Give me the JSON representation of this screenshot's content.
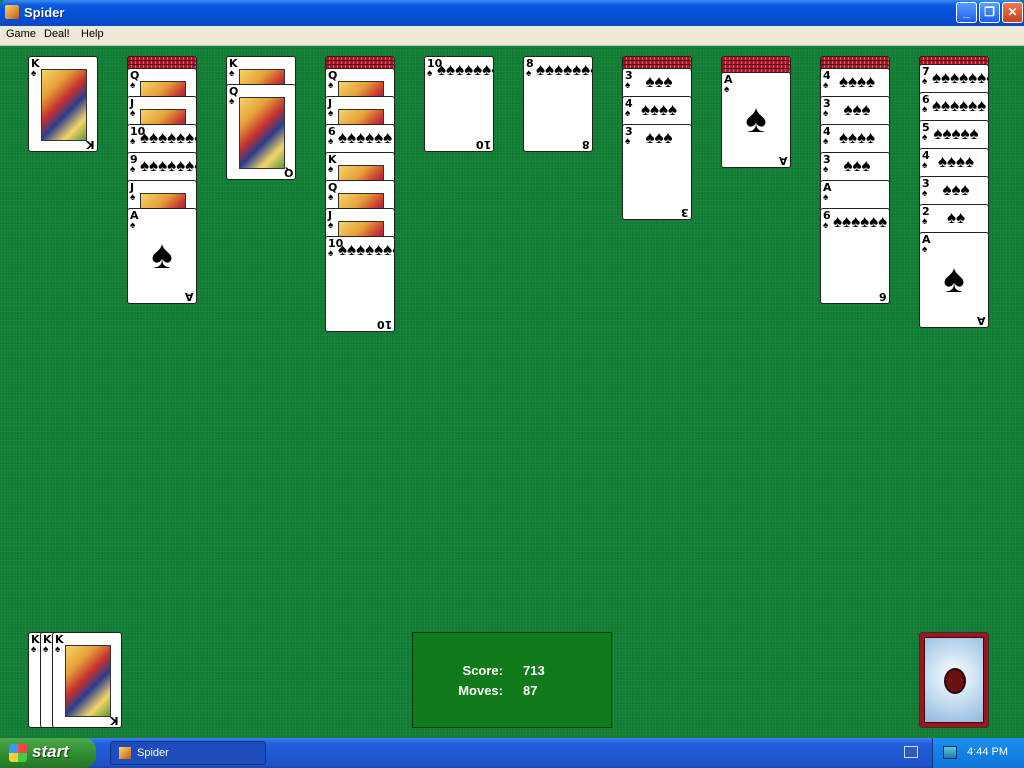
{
  "window": {
    "title": "Spider"
  },
  "menu": [
    "Game",
    "Deal!",
    "Help"
  ],
  "colors": {
    "felt": "#117c33",
    "card_back": "#b81024",
    "status_bg": "#117a1a"
  },
  "tableau": [
    {
      "backs": 0,
      "cards": [
        "K"
      ]
    },
    {
      "backs": 3,
      "cards": [
        "Q",
        "J",
        "10",
        "9",
        "J",
        "A"
      ]
    },
    {
      "backs": 0,
      "cards": [
        "K",
        "Q"
      ]
    },
    {
      "backs": 3,
      "cards": [
        "Q",
        "J",
        "6",
        "K",
        "Q",
        "J",
        "10"
      ]
    },
    {
      "backs": 0,
      "cards": [
        "10"
      ]
    },
    {
      "backs": 0,
      "cards": [
        "8"
      ]
    },
    {
      "backs": 3,
      "cards": [
        "3",
        "4",
        "3"
      ]
    },
    {
      "backs": 4,
      "cards": [
        "A"
      ]
    },
    {
      "backs": 3,
      "cards": [
        "4",
        "3",
        "4",
        "3",
        "A",
        "6"
      ]
    },
    {
      "backs": 2,
      "cards": [
        "7",
        "6",
        "5",
        "4",
        "3",
        "2",
        "A"
      ]
    }
  ],
  "completed_suits": [
    "K",
    "K",
    "K"
  ],
  "status": {
    "score_label": "Score:",
    "score": "713",
    "moves_label": "Moves:",
    "moves": "87"
  },
  "taskbar": {
    "start_label": "start",
    "task_label": "Spider",
    "clock": "4:44 PM"
  }
}
